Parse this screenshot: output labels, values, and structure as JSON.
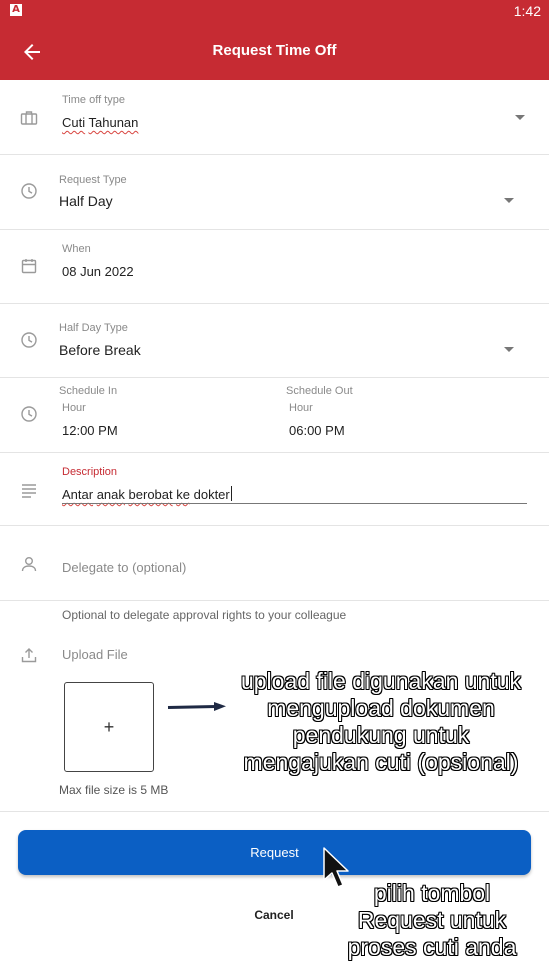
{
  "status_bar": {
    "app_icon": "A",
    "time": "1:42"
  },
  "app_bar": {
    "back_icon": "arrow-left-icon",
    "title": "Request Time Off"
  },
  "colors": {
    "primary_red": "#c62b33",
    "primary_blue": "#0b5fc4"
  },
  "form": {
    "time_off_type": {
      "label": "Time off type",
      "value_word1": "Cuti",
      "value_word2": "Tahunan",
      "icon": "briefcase-icon"
    },
    "request_type": {
      "label": "Request Type",
      "value": "Half Day",
      "icon": "clock-icon"
    },
    "when": {
      "label": "When",
      "value": "08 Jun 2022",
      "icon": "calendar-icon"
    },
    "half_day_type": {
      "label": "Half Day Type",
      "value": "Before Break",
      "icon": "clock-icon"
    },
    "schedule": {
      "icon": "clock-icon",
      "in_label": "Schedule In",
      "in_sublabel": "Hour",
      "in_value": "12:00 PM",
      "out_label": "Schedule Out",
      "out_sublabel": "Hour",
      "out_value": "06:00 PM"
    },
    "description": {
      "label": "Description",
      "words": [
        "Antar",
        "anak",
        "berobat",
        "ke",
        "dokter"
      ],
      "icon": "notes-icon"
    },
    "delegate": {
      "placeholder": "Delegate to (optional)",
      "helper": "Optional to delegate approval rights to your colleague",
      "icon": "person-icon"
    },
    "upload": {
      "label": "Upload File",
      "add_symbol": "+",
      "max_size": "Max file size is 5 MB",
      "icon": "upload-icon"
    }
  },
  "actions": {
    "request_label": "Request",
    "cancel_label": "Cancel"
  },
  "annotations": {
    "upload_note": [
      "upload file digunakan untuk",
      "mengupload dokumen",
      "pendukung untuk",
      "mengajukan cuti (opsional)"
    ],
    "request_note": [
      "pilih tombol",
      "Request untuk",
      "proses cuti anda"
    ]
  }
}
